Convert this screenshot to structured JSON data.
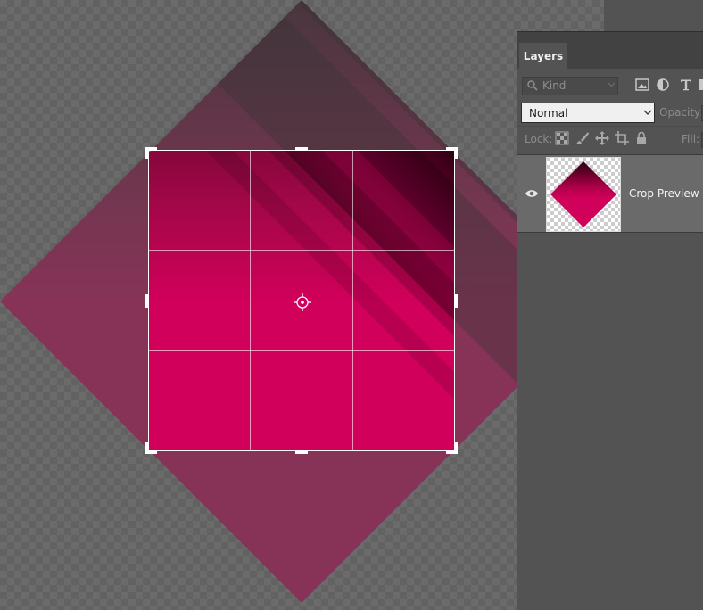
{
  "canvas": {
    "colors": {
      "checker_light": "#8c8c8c",
      "checker_dark": "#767676",
      "shape_fill": "#d1005a",
      "shape_shadow": "#300014",
      "crop_outside_dim": "#565656",
      "crop_grid": "#ffffff"
    },
    "crop_overlay": {
      "grid_rows": 3,
      "grid_cols": 3,
      "center_marker": "crosshair-target-icon"
    }
  },
  "layers_panel": {
    "tab_label": "Layers",
    "filter": {
      "kind_label": "Kind",
      "search_icon": "search-icon",
      "filter_icons": [
        "image-filter-icon",
        "adjustment-filter-icon",
        "type-filter-icon",
        "shape-filter-icon"
      ]
    },
    "blend_mode": "Normal",
    "opacity_label": "Opacity:",
    "lock_label": "Lock:",
    "lock_icons": [
      "lock-transparent-pixels-icon",
      "lock-image-pixels-icon",
      "lock-position-icon",
      "lock-artboard-icon",
      "lock-all-icon"
    ],
    "fill_label": "Fill:",
    "layers": [
      {
        "name": "Crop Preview",
        "visible": true,
        "selected": true
      }
    ]
  }
}
